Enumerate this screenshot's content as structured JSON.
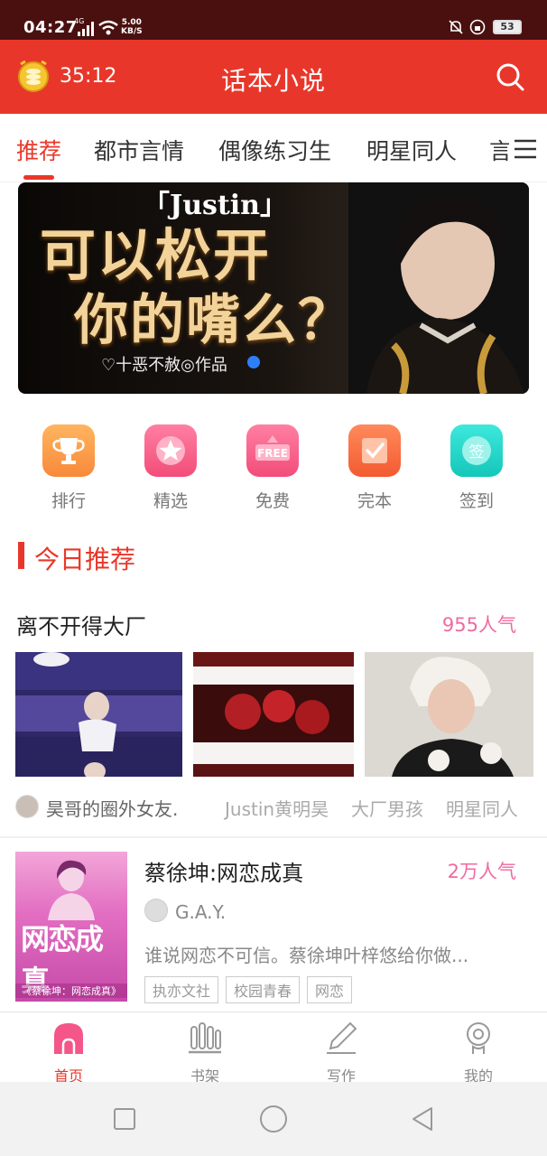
{
  "status_bar": {
    "time": "04:27",
    "network": "4G",
    "speed_value": "5.00",
    "speed_unit": "KB/S",
    "battery": "53"
  },
  "header": {
    "timer": "35:12",
    "title": "话本小说",
    "accent_color": "#e8372a"
  },
  "tabs": [
    {
      "label": "推荐",
      "active": true
    },
    {
      "label": "都市言情",
      "active": false
    },
    {
      "label": "偶像练习生",
      "active": false
    },
    {
      "label": "明星同人",
      "active": false
    },
    {
      "label": "言",
      "active": false
    }
  ],
  "banner": {
    "title_en": "「Justin」",
    "line1": "可以松开",
    "line2": "你的嘴么？",
    "author": "♡十恶不赦◎作品"
  },
  "quick_entries": [
    {
      "label": "排行",
      "icon": "trophy-icon",
      "color": "#f9a04a"
    },
    {
      "label": "精选",
      "icon": "star-icon",
      "color": "#f45f86"
    },
    {
      "label": "免费",
      "icon": "free-icon",
      "color": "#f45f86"
    },
    {
      "label": "完本",
      "icon": "check-icon",
      "color": "#f6663c"
    },
    {
      "label": "签到",
      "icon": "sign-icon",
      "color": "#22d3c5"
    }
  ],
  "section": {
    "title": "今日推荐"
  },
  "card1": {
    "title": "离不开得大厂",
    "popularity": "955人气",
    "author": "昊哥的圈外女友.",
    "tags": [
      "Justin黄明昊",
      "大厂男孩",
      "明星同人"
    ]
  },
  "card2": {
    "title": "蔡徐坤:网恋成真",
    "popularity": "2万人气",
    "author": "G.A.Y.",
    "description": "谁说网恋不可信。蔡徐坤叶梓悠给你做...",
    "tags": [
      "执亦文社",
      "校园青春",
      "网恋"
    ],
    "cover_title": "网恋成真",
    "cover_sub": "《蔡徐坤：网恋成真》"
  },
  "bottom_nav": [
    {
      "label": "首页",
      "icon": "home-icon",
      "active": true
    },
    {
      "label": "书架",
      "icon": "bookshelf-icon",
      "active": false
    },
    {
      "label": "写作",
      "icon": "pen-icon",
      "active": false
    },
    {
      "label": "我的",
      "icon": "profile-icon",
      "active": false
    }
  ]
}
